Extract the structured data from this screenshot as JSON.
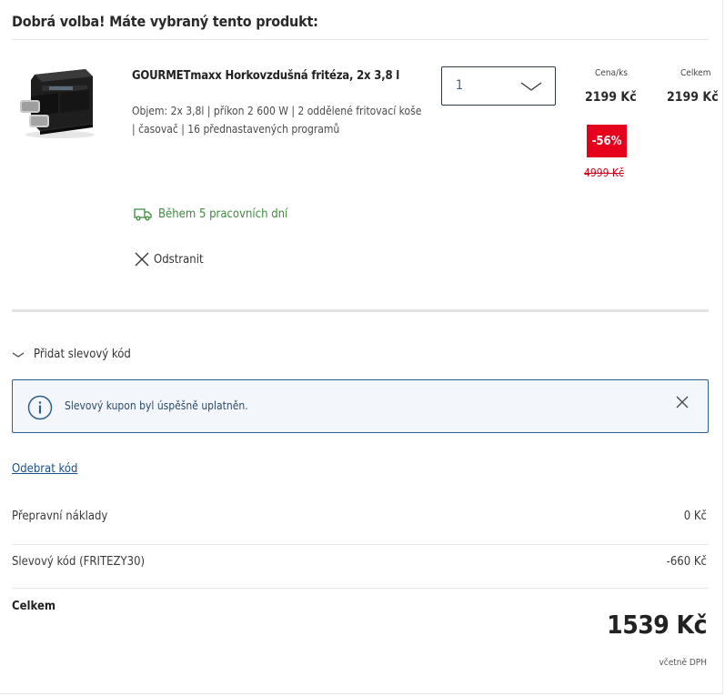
{
  "header": {
    "title": "Dobrá volba! Máte vybraný tento produkt:"
  },
  "product": {
    "name": "GOURMETmaxx Horkovzdušná fritéza, 2x 3,8 l",
    "description": "Objem: 2x 3,8l | příkon 2 600 W | 2 oddělené fritovací koše | časovač | 16 přednastavených programů",
    "quantity": "1",
    "unit_price_label": "Cena/ks",
    "total_label": "Celkem",
    "unit_price": "2199 Kč",
    "total_price": "2199 Kč",
    "discount_badge": "-56%",
    "old_price": "4999 Kč",
    "delivery": "Během 5 pracovních dní",
    "remove_label": "Odstranit"
  },
  "promo": {
    "toggle_label": "Přidat slevový kód",
    "info_message": "Slevový kupon byl úspěšně uplatněn.",
    "remove_code_label": "Odebrat kód"
  },
  "summary": {
    "shipping_label": "Přepravní náklady",
    "shipping_value": "0 Kč",
    "discount_label": "Slevový kód (FRITEZY30)",
    "discount_value": "-660 Kč",
    "total_label": "Celkem",
    "total_value": "1539 Kč",
    "vat_note": "včetně DPH"
  },
  "colors": {
    "accent_red": "#e5001b",
    "delivery_green": "#3e8a3e",
    "info_border": "#2c5f8d",
    "link_blue": "#1b4f8a"
  },
  "icons": {
    "quantity_chevron": "chevron-down-icon",
    "delivery": "truck-icon",
    "remove": "close-icon",
    "promo_toggle": "chevron-down-icon",
    "info": "info-icon",
    "info_close": "close-icon"
  }
}
